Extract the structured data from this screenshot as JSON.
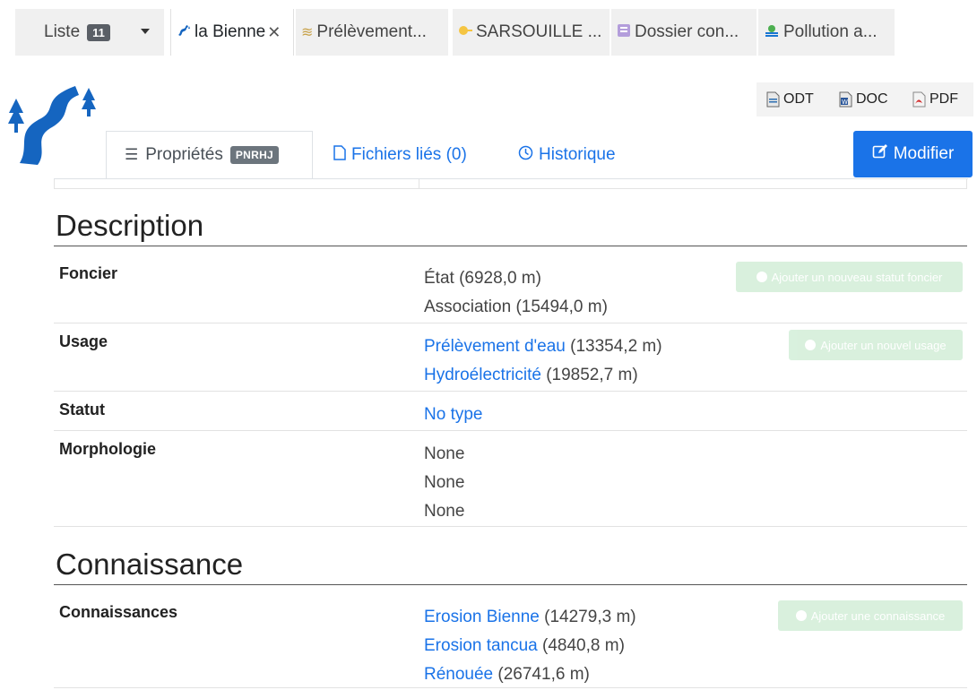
{
  "tabs": [
    {
      "label": "Liste",
      "badge": "11",
      "icon": "caret-down-icon"
    },
    {
      "label": "la Bienne",
      "icon": "river-icon",
      "active": true
    },
    {
      "label": "Prélèvement...",
      "icon": "waves-icon"
    },
    {
      "label": "SARSOUILLE ...",
      "icon": "key-icon"
    },
    {
      "label": "Dossier con...",
      "icon": "folder-icon"
    },
    {
      "label": "Pollution a...",
      "icon": "pollution-icon"
    }
  ],
  "export": {
    "odt": "ODT",
    "doc": "DOC",
    "pdf": "PDF"
  },
  "page_tabs": {
    "properties": {
      "label": "Propriétés",
      "badge": "PNRHJ"
    },
    "files": {
      "label": "Fichiers liés (0)"
    },
    "history": {
      "label": "Historique"
    }
  },
  "modify_label": "Modifier",
  "description": {
    "title": "Description",
    "rows": [
      {
        "label": "Foncier",
        "values": [
          {
            "text": "État",
            "suffix": " (6928,0 m)",
            "link": false
          },
          {
            "text": "Association",
            "suffix": " (15494,0 m)",
            "link": false
          }
        ],
        "action": "Ajouter un nouveau statut foncier"
      },
      {
        "label": "Usage",
        "values": [
          {
            "text": "Prélèvement d'eau",
            "suffix": " (13354,2 m)",
            "link": true
          },
          {
            "text": "Hydroélectricité",
            "suffix": " (19852,7 m)",
            "link": true
          }
        ],
        "action": "Ajouter un nouvel usage"
      },
      {
        "label": "Statut",
        "values": [
          {
            "text": "No type",
            "suffix": "",
            "link": true
          }
        ]
      },
      {
        "label": "Morphologie",
        "values": [
          {
            "text": "None",
            "suffix": "",
            "link": false
          },
          {
            "text": "None",
            "suffix": "",
            "link": false
          },
          {
            "text": "None",
            "suffix": "",
            "link": false
          }
        ]
      }
    ]
  },
  "connaissance": {
    "title": "Connaissance",
    "rows": [
      {
        "label": "Connaissances",
        "values": [
          {
            "text": "Erosion Bienne",
            "suffix": " (14279,3 m)",
            "link": true
          },
          {
            "text": "Erosion tancua",
            "suffix": " (4840,8 m)",
            "link": true
          },
          {
            "text": "Rénouée",
            "suffix": " (26741,6 m)",
            "link": true
          }
        ],
        "action": "Ajouter une connaissance"
      }
    ]
  },
  "colors": {
    "primary": "#1a73e8",
    "logo_blue": "#1565c0",
    "add_button": "#d7f0dc"
  }
}
